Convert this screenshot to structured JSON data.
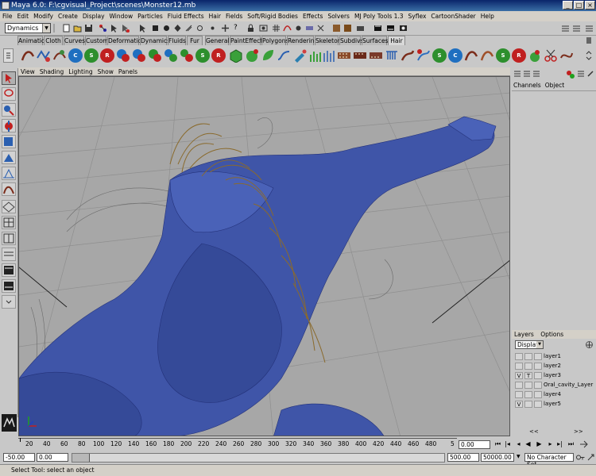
{
  "window": {
    "title": "Maya 6.0: F:\\cgvisual_Project\\scenes\\Monster12.mb",
    "minimize": "_",
    "maximize": "□",
    "close": "×"
  },
  "menu": [
    "File",
    "Edit",
    "Modify",
    "Create",
    "Display",
    "Window",
    "Particles",
    "Fluid Effects",
    "Hair",
    "Fields",
    "Soft/Rigid Bodies",
    "Effects",
    "Solvers",
    "MJ Poly Tools 1.3",
    "Syflex",
    "CartoonShader",
    "Help"
  ],
  "status": {
    "menuset": "Dynamics"
  },
  "shelf_tabs": [
    "Animation",
    "Cloth",
    "Curves",
    "Custom",
    "Deformation",
    "Dynamics",
    "Fluids",
    "Fur",
    "General",
    "PaintEffects",
    "Polygons",
    "Rendering",
    "Skeleton",
    "Subdivs",
    "Surfaces",
    "Hair"
  ],
  "active_shelf_tab": "Hair",
  "panel_menu": [
    "View",
    "Shading",
    "Lighting",
    "Show",
    "Panels"
  ],
  "channel_box": {
    "tabs": [
      "Channels",
      "Object"
    ]
  },
  "layers": {
    "menu": [
      "Layers",
      "Options"
    ],
    "display_option": "Display",
    "rows": [
      {
        "v": "",
        "t": "",
        "name": "layer1"
      },
      {
        "v": "",
        "t": "",
        "name": "layer2"
      },
      {
        "v": "V",
        "t": "T",
        "name": "layer3"
      },
      {
        "v": "",
        "t": "",
        "name": "Oral_cavity_Layer"
      },
      {
        "v": "",
        "t": "",
        "name": "layer4"
      },
      {
        "v": "V",
        "t": "",
        "name": "layer5"
      }
    ],
    "scroll_left": "<<",
    "scroll_right": ">>"
  },
  "timeline": {
    "ticks": [
      "20",
      "40",
      "60",
      "80",
      "100",
      "120",
      "140",
      "160",
      "180",
      "200",
      "220",
      "240",
      "260",
      "280",
      "300",
      "320",
      "340",
      "360",
      "380",
      "400",
      "420",
      "440",
      "460",
      "480",
      "5"
    ],
    "current_frame": "0.00"
  },
  "range": {
    "start": "-50.00",
    "playback_start": "0.00",
    "playback_end": "500.00",
    "end": "50000.00",
    "character_set": "No Character Set"
  },
  "help_line": "Select Tool: select an object",
  "colors": {
    "viewport_bg": "#a7a7a7",
    "mesh_blue": "#3f55a8",
    "fur_brown": "#8a6a2c",
    "title_blue": "#0a246a"
  }
}
